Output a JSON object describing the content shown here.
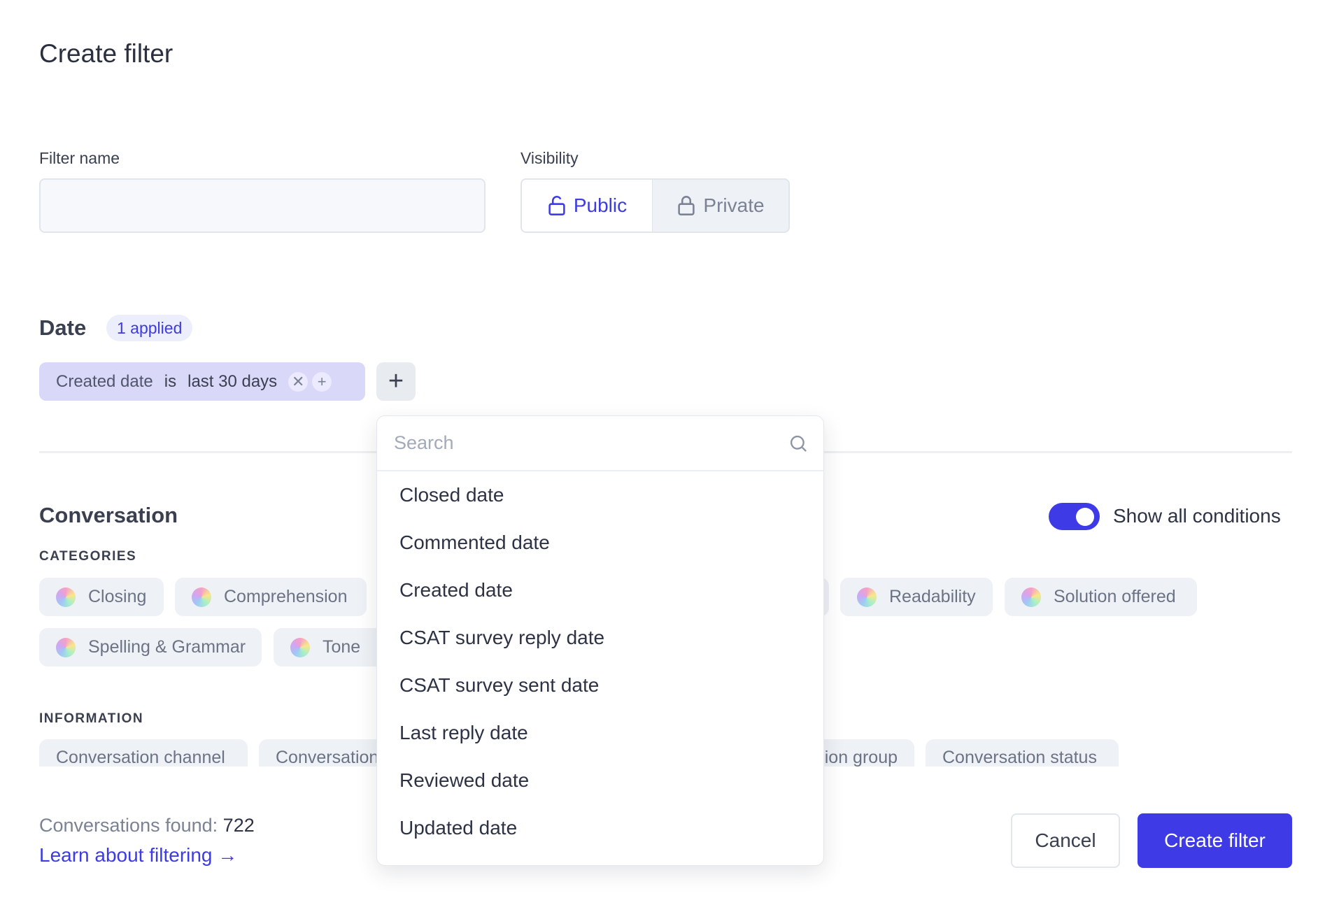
{
  "title": "Create filter",
  "filter_name": {
    "label": "Filter name",
    "value": "",
    "placeholder": ""
  },
  "visibility": {
    "label": "Visibility",
    "options": [
      {
        "label": "Public",
        "icon": "unlock-icon",
        "selected": true
      },
      {
        "label": "Private",
        "icon": "lock-icon",
        "selected": false
      }
    ]
  },
  "date": {
    "heading": "Date",
    "badge": "1 applied",
    "condition": {
      "field": "Created date",
      "operator": "is",
      "value": "last 30 days"
    }
  },
  "dropdown": {
    "search_placeholder": "Search",
    "items": [
      "Closed date",
      "Commented date",
      "Created date",
      "CSAT survey reply date",
      "CSAT survey sent date",
      "Last reply date",
      "Reviewed date",
      "Updated date"
    ]
  },
  "conversation": {
    "heading": "Conversation",
    "toggle": {
      "label": "Show all conditions",
      "on": true
    },
    "categories_label": "CATEGORIES",
    "categories": [
      "Closing",
      "Comprehension",
      "Readability",
      "Solution offered",
      "Spelling & Grammar",
      "Tone"
    ],
    "information_label": "INFORMATION",
    "information": [
      "Conversation channel",
      "Conversation",
      "ion group",
      "Conversation status"
    ]
  },
  "footer": {
    "found_label": "Conversations found:",
    "found_count": "722",
    "learn_link": "Learn about filtering →",
    "cancel": "Cancel",
    "create": "Create filter"
  },
  "colors": {
    "accent": "#3e3be6",
    "chip": "#d9d8f8"
  }
}
